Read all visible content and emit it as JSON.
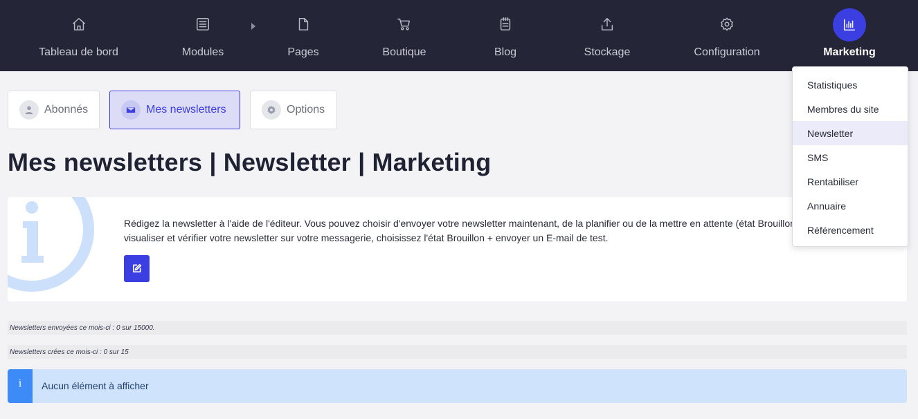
{
  "nav": {
    "items": [
      {
        "label": "Tableau de bord",
        "icon": "home-icon"
      },
      {
        "label": "Modules",
        "icon": "list-icon"
      },
      {
        "label": "Pages",
        "icon": "file-icon"
      },
      {
        "label": "Boutique",
        "icon": "cart-icon"
      },
      {
        "label": "Blog",
        "icon": "notepad-icon"
      },
      {
        "label": "Stockage",
        "icon": "upload-icon"
      },
      {
        "label": "Configuration",
        "icon": "gear-icon"
      },
      {
        "label": "Marketing",
        "icon": "bar-chart-icon",
        "active": true
      }
    ]
  },
  "tabs": [
    {
      "label": "Abonnés",
      "icon": "user-icon"
    },
    {
      "label": "Mes newsletters",
      "icon": "envelope-icon",
      "active": true
    },
    {
      "label": "Options",
      "icon": "gear-icon"
    }
  ],
  "page": {
    "title": "Mes newsletters | Newsletter | Marketing"
  },
  "info": {
    "line1": "Rédigez la newsletter à l'aide de l'éditeur. Vous pouvez choisir d'envoyer votre newsletter maintenant, de la planifier ou de la mettre en attente (état Brouillon). Pour",
    "line2": "visualiser et vérifier votre newsletter sur votre messagerie, choisissez l'état Brouillon + envoyer un E-mail de test.",
    "icon": "info-icon",
    "edit_icon": "edit-icon"
  },
  "stats": {
    "sent": "Newsletters envoyées ce mois-ci : 0 sur 15000.",
    "created": "Newsletters crées ce mois-ci : 0 sur 15"
  },
  "alert": {
    "icon_glyph": "i",
    "text": "Aucun élément à afficher"
  },
  "dropdown": {
    "items": [
      {
        "label": "Statistiques"
      },
      {
        "label": "Membres du site"
      },
      {
        "label": "Newsletter",
        "active": true
      },
      {
        "label": "SMS"
      },
      {
        "label": "Rentabiliser"
      },
      {
        "label": "Annuaire"
      },
      {
        "label": "Référencement"
      }
    ]
  },
  "colors": {
    "nav_bg": "#242638",
    "accent": "#3b3ee0",
    "page_bg": "#f3f3f6",
    "alert_bg": "#cfe3fd",
    "alert_icon_bg": "#3d8bf6"
  }
}
